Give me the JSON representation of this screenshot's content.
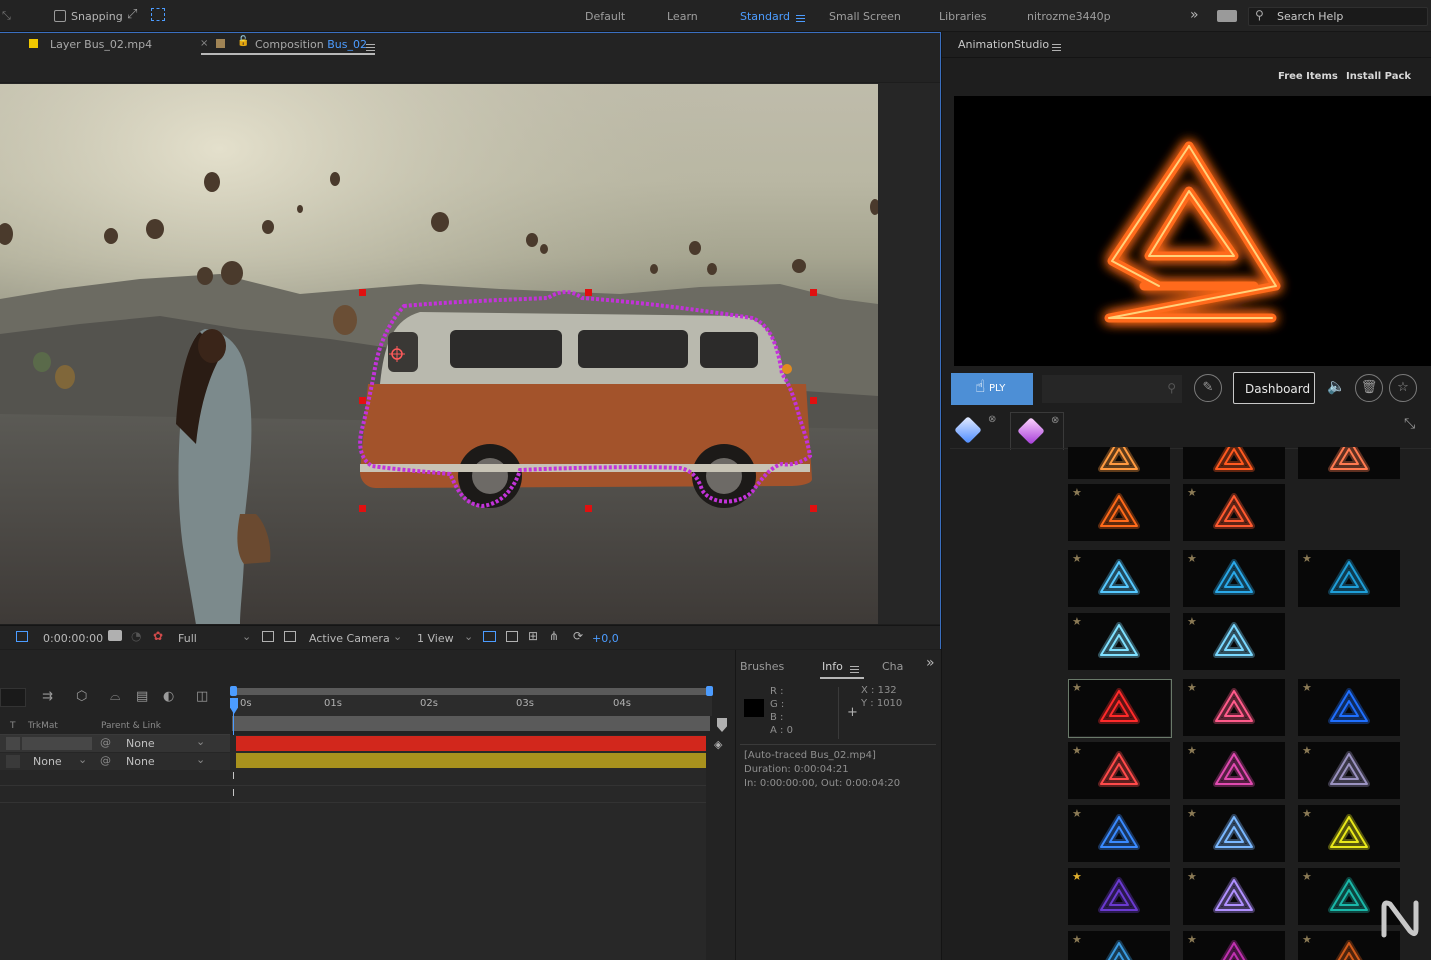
{
  "topbar": {
    "snapping_label": "Snapping",
    "workspaces": [
      "Default",
      "Learn",
      "Standard",
      "Small Screen",
      "Libraries",
      "nitrozme3440p"
    ],
    "active_workspace": "Standard",
    "search_placeholder": "Search Help"
  },
  "comp": {
    "tab_layer": "Layer Bus_02.mp4",
    "tab_comp_prefix": "Composition",
    "tab_comp_name": "Bus_02",
    "timecode": "0:00:00:00",
    "resolution": "Full",
    "camera": "Active Camera",
    "views": "1 View",
    "exposure": "+0,0"
  },
  "timeline": {
    "col_trkmat": "TrkMat",
    "col_t": "T",
    "col_parent": "Parent & Link",
    "ruler_labels": [
      "0s",
      "01s",
      "02s",
      "03s",
      "04s"
    ],
    "rows": [
      {
        "trkmat": "",
        "parent": "None",
        "bar_color": "#d2271c"
      },
      {
        "trkmat": "None",
        "parent": "None",
        "bar_color": "#a8911d"
      }
    ]
  },
  "info": {
    "tabs": [
      "Brushes",
      "Info",
      "Cha"
    ],
    "r": "R :",
    "g": "G :",
    "b": "B :",
    "a": "A :  0",
    "x": "X : 132",
    "y": "Y : 1010",
    "source": "[Auto-traced Bus_02.mp4]",
    "duration": "Duration: 0:00:04:21",
    "inout": "In: 0:00:00:00, Out: 0:00:04:20"
  },
  "anim": {
    "title": "AnimationStudio",
    "free_items": "Free Items",
    "install_pack": "Install Pack",
    "apply_label": "PLY",
    "dashboard_label": "Dashboard",
    "colors": {
      "accent": "#4d8fd6",
      "fire": "#ff6a1a"
    },
    "thumbs": [
      {
        "color": "#ff9a40",
        "star": false
      },
      {
        "color": "#ff5a20",
        "star": false
      },
      {
        "color": "#ff7a50",
        "star": false
      },
      {
        "color": "#ff6a1a",
        "star": true
      },
      {
        "color": "#ff5a30",
        "star": true
      },
      {
        "color": null,
        "star": false
      },
      {
        "color": "#56c8ff",
        "star": true
      },
      {
        "color": "#2aa8e8",
        "star": true
      },
      {
        "color": "#1f9ed8",
        "star": true
      },
      {
        "color": "#7fe0ff",
        "star": true
      },
      {
        "color": "#7ad8ff",
        "star": true
      },
      {
        "color": null,
        "star": false
      },
      {
        "color": "#ff2a2a",
        "star": true
      },
      {
        "color": "#ff5a8a",
        "star": true
      },
      {
        "color": "#1f6fff",
        "star": true
      },
      {
        "color": "#ff4a4a",
        "star": true
      },
      {
        "color": "#e04ab0",
        "star": true
      },
      {
        "color": "#9a92c0",
        "star": true
      },
      {
        "color": "#3a8aff",
        "star": true
      },
      {
        "color": "#7ab8ff",
        "star": true
      },
      {
        "color": "#e8e81a",
        "star": true
      },
      {
        "color": "#6a3ad0",
        "star": true,
        "gold": true
      },
      {
        "color": "#b090ff",
        "star": true
      },
      {
        "color": "#1ab8a8",
        "star": true
      },
      {
        "color": "#3a9ae0",
        "star": true
      },
      {
        "color": "#c030b0",
        "star": true
      },
      {
        "color": "#d05a1a",
        "star": true
      }
    ]
  }
}
